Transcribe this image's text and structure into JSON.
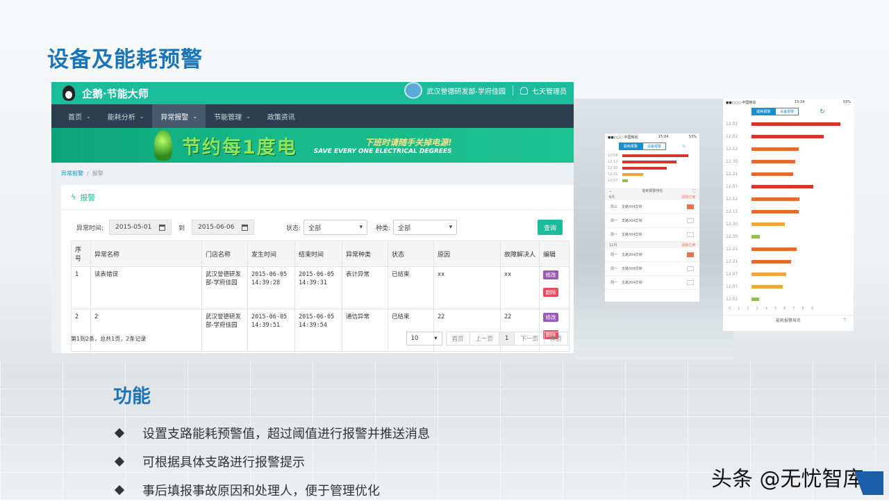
{
  "slide": {
    "title": "设备及能耗预警",
    "section_title": "功能",
    "bullets": [
      "设置支路能耗预警值，超过阈值进行报警并推送消息",
      "可根据具体支路进行报警提示",
      "事后填报事故原因和处理人，便于管理优化"
    ],
    "watermark": "头条 @无忧智库"
  },
  "app": {
    "name": "企鹅·节能大师",
    "org": "武汉誉德研发部-学府佳园",
    "user": "七天管理员",
    "nav": [
      "首页",
      "能耗分析",
      "异常报警",
      "节能管理",
      "政策资讯"
    ],
    "nav_active": "异常报警",
    "banner_cn": "节约每1度电",
    "banner_slogan": "下班时请随手关掉电源!",
    "banner_en": "SAVE EVERY ONE ELECTRICAL DEGREES",
    "breadcrumb": [
      "异常报警",
      "报警"
    ],
    "panel_title": "报警",
    "filter": {
      "time_label": "异常时间:",
      "from": "2015-05-01",
      "to_label": "到",
      "to": "2015-06-06",
      "status_label": "状态:",
      "status_value": "全部",
      "type_label": "种类:",
      "type_value": "全部",
      "query": "查询"
    },
    "table": {
      "headers": [
        "序号",
        "异常名称",
        "门店名称",
        "发生时间",
        "结束时间",
        "异常种类",
        "状态",
        "原因",
        "故障解决人",
        "编辑"
      ],
      "rows": [
        [
          "1",
          "读表错误",
          "武汉誉德研发部-学府佳园",
          "2015-06-05 14:39:28",
          "2015-06-05 14:39:31",
          "表计异常",
          "已结束",
          "xx",
          "xx"
        ],
        [
          "2",
          "2",
          "武汉誉德研发部-学府佳园",
          "2015-06-05 14:39:51",
          "2015-06-05 14:39:54",
          "通信异常",
          "已结束",
          "22",
          "22"
        ]
      ],
      "edit_label": "修改",
      "delete_label": "删除"
    },
    "footer_info": "第1到2条，总共1页，2条记录",
    "page_size": "10",
    "pager": [
      "首页",
      "上一页",
      "1",
      "下一页",
      "末页"
    ]
  },
  "phone_small": {
    "carrier": "●●○○○ 中国移动 ",
    "time": "15:24",
    "battery": "53% ",
    "tabs": [
      "能耗报警",
      "设备报警"
    ],
    "bar_labels": [
      "12:08",
      "12:12",
      "12:30",
      "12:21",
      "12:07"
    ],
    "bar_values": [
      9.5,
      7.8,
      6.4,
      3.0,
      0.8
    ],
    "list_title": "能耗报警排名",
    "sections": [
      {
        "head": "6月",
        "tag": "清除已读",
        "items": [
          [
            "周三",
            "支路304异常"
          ],
          [
            "周一",
            "支路304异常"
          ],
          [
            "周一",
            "支路304异常"
          ]
        ]
      },
      {
        "head": "11月",
        "tag": "清除已读",
        "items": [
          [
            "周一",
            "支路304异常"
          ],
          [
            "周一",
            "支路304异常"
          ],
          [
            "周一",
            "支路304异常"
          ]
        ]
      }
    ]
  },
  "phone_large": {
    "carrier": "●●○○○ 中国移动 ",
    "time": "15:24",
    "battery": "53% ",
    "tabs": [
      "能耗报警",
      "设备报警"
    ],
    "bar_labels": [
      "12.02",
      "12.02",
      "12.12",
      "12.30",
      "12.21",
      "12.07",
      "12.12",
      "12.12",
      "12.30",
      "12.30",
      "12.21",
      "12.21",
      "12.07",
      "12.07",
      "12.02"
    ],
    "bar_values": [
      8.5,
      6.9,
      4.5,
      4.2,
      4.0,
      5.9,
      4.6,
      4.5,
      3.2,
      0.8,
      4.3,
      3.8,
      3.3,
      3.0,
      0.7
    ],
    "x_ticks": [
      "0",
      "1",
      "2",
      "3",
      "4",
      "5",
      "6",
      "7",
      "8",
      "9"
    ],
    "footer": "能耗报警排名"
  }
}
